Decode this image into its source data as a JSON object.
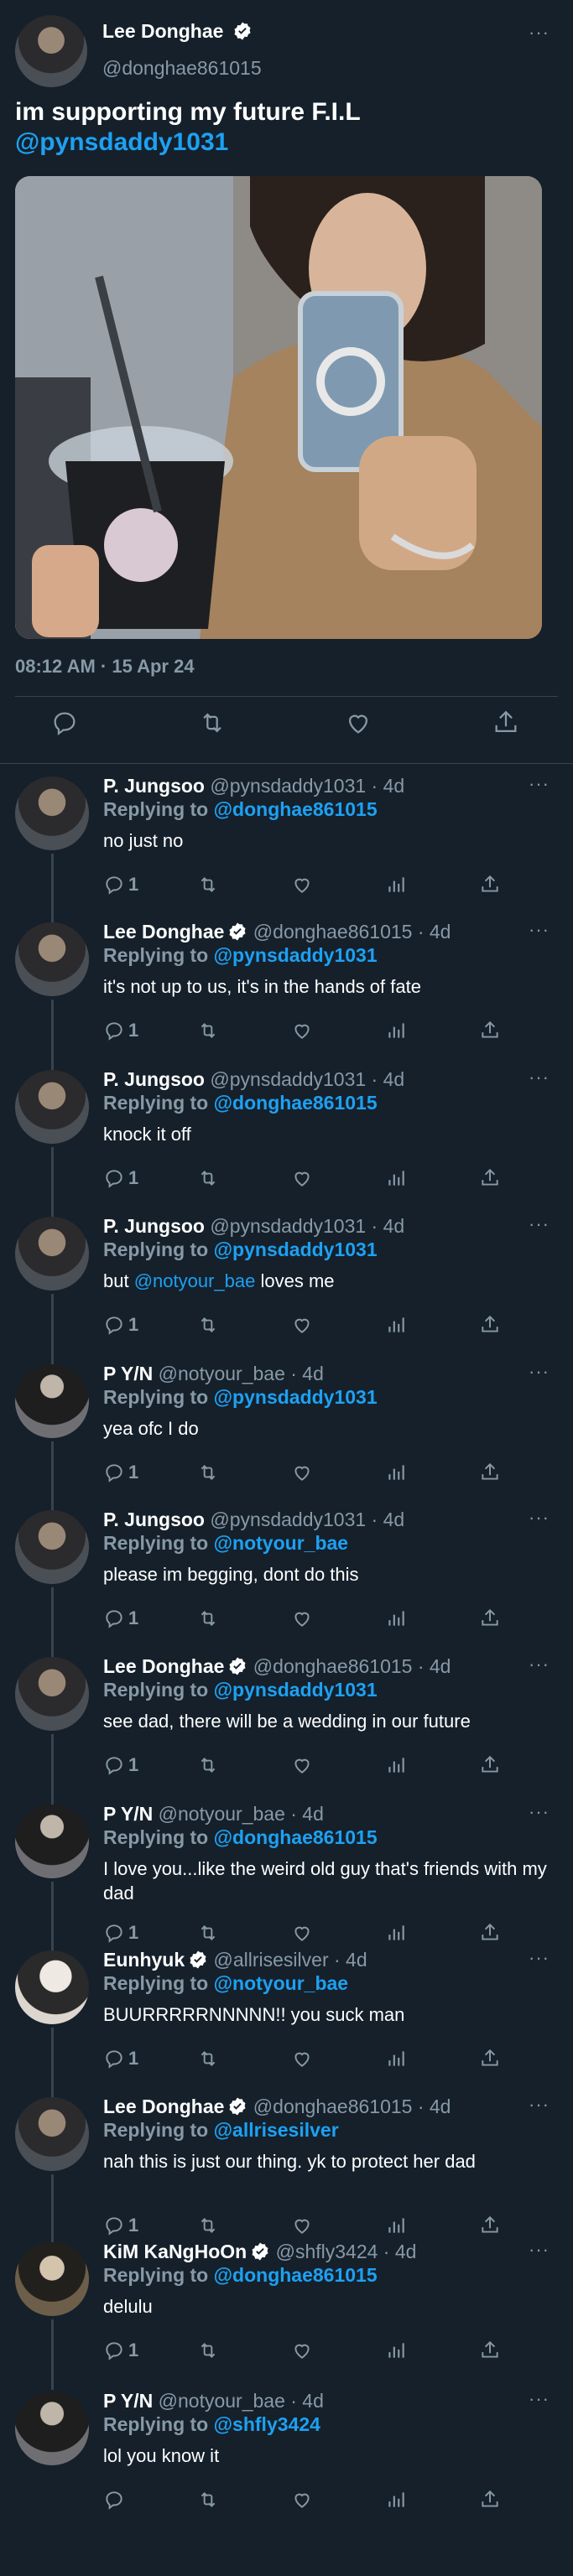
{
  "tweet": {
    "author_name": "Lee Donghae",
    "author_handle": "@donghae861015",
    "text_line1": "im supporting my future F.I.L",
    "text_mention": "@pynsdaddy1031",
    "timestamp": "08:12 AM · 15 Apr 24",
    "more": "···"
  },
  "replies": [
    {
      "name": "P. Jungsoo",
      "handle": "@pynsdaddy1031 · 4d",
      "replying_prefix": "Replying to",
      "replying_to": "@donghae861015",
      "text": "no just no",
      "reply_count": "1",
      "verified": false
    },
    {
      "name": "Lee Donghae",
      "handle": "@donghae861015 · 4d",
      "replying_prefix": "Replying to",
      "replying_to": "@pynsdaddy1031",
      "text": "it's not up to us, it's in the hands of fate",
      "reply_count": "1",
      "verified": true
    },
    {
      "name": "P. Jungsoo",
      "handle": "@pynsdaddy1031 · 4d",
      "replying_prefix": "Replying to",
      "replying_to": "@donghae861015",
      "text": "knock it off",
      "reply_count": "1",
      "verified": false
    },
    {
      "name": "P. Jungsoo",
      "handle": "@pynsdaddy1031 · 4d",
      "replying_prefix": "Replying to",
      "replying_to": "@pynsdaddy1031",
      "text_pre": "but ",
      "text_mention": "@notyour_bae",
      "text_post": " loves me",
      "reply_count": "1",
      "verified": false
    },
    {
      "name": "P Y/N",
      "handle": "@notyour_bae · 4d",
      "replying_prefix": "Replying to",
      "replying_to": "@pynsdaddy1031",
      "text": "yea ofc I do",
      "reply_count": "1",
      "verified": false
    },
    {
      "name": "P. Jungsoo",
      "handle": "@pynsdaddy1031 · 4d",
      "replying_prefix": "Replying to",
      "replying_to": "@notyour_bae",
      "text": "please im begging, dont do this",
      "reply_count": "1",
      "verified": false
    },
    {
      "name": "Lee Donghae",
      "handle": "@donghae861015 · 4d",
      "replying_prefix": "Replying to",
      "replying_to": "@pynsdaddy1031",
      "text": "see dad, there will be a wedding in our future",
      "reply_count": "1",
      "verified": true
    },
    {
      "name": "P Y/N",
      "handle": "@notyour_bae · 4d",
      "replying_prefix": "Replying to",
      "replying_to": "@donghae861015",
      "text": "I love you...like the weird old guy that's friends with my dad",
      "reply_count": "1",
      "verified": false
    },
    {
      "name": "Eunhyuk",
      "handle": "@allrisesilver · 4d",
      "replying_prefix": "Replying to",
      "replying_to": "@notyour_bae",
      "text": "BUURRRRRNNNNN!! you suck man",
      "reply_count": "1",
      "verified": true
    },
    {
      "name": "Lee Donghae",
      "handle": "@donghae861015 · 4d",
      "replying_prefix": "Replying to",
      "replying_to": "@allrisesilver",
      "text": "nah this is just our thing. yk to protect her dad",
      "reply_count": "1",
      "verified": true
    },
    {
      "name": "KiM KaNgHoOn",
      "handle": "@shfly3424 · 4d",
      "replying_prefix": "Replying to",
      "replying_to": "@donghae861015",
      "text": "delulu",
      "reply_count": "1",
      "verified": true
    },
    {
      "name": "P Y/N",
      "handle": "@notyour_bae · 4d",
      "replying_prefix": "Replying to",
      "replying_to": "@shfly3424",
      "text": "lol you know it",
      "reply_count": "",
      "verified": false
    }
  ],
  "icons": {
    "reply": "reply-icon",
    "retweet": "retweet-icon",
    "like": "heart-icon",
    "views": "views-icon",
    "share": "share-icon",
    "verified": "verified-badge-icon",
    "more": "more-icon"
  },
  "colors": {
    "background": "#15202b",
    "link": "#1da1f2",
    "muted": "#8899a6",
    "divider": "#38444d",
    "verified": "#ffffff"
  }
}
